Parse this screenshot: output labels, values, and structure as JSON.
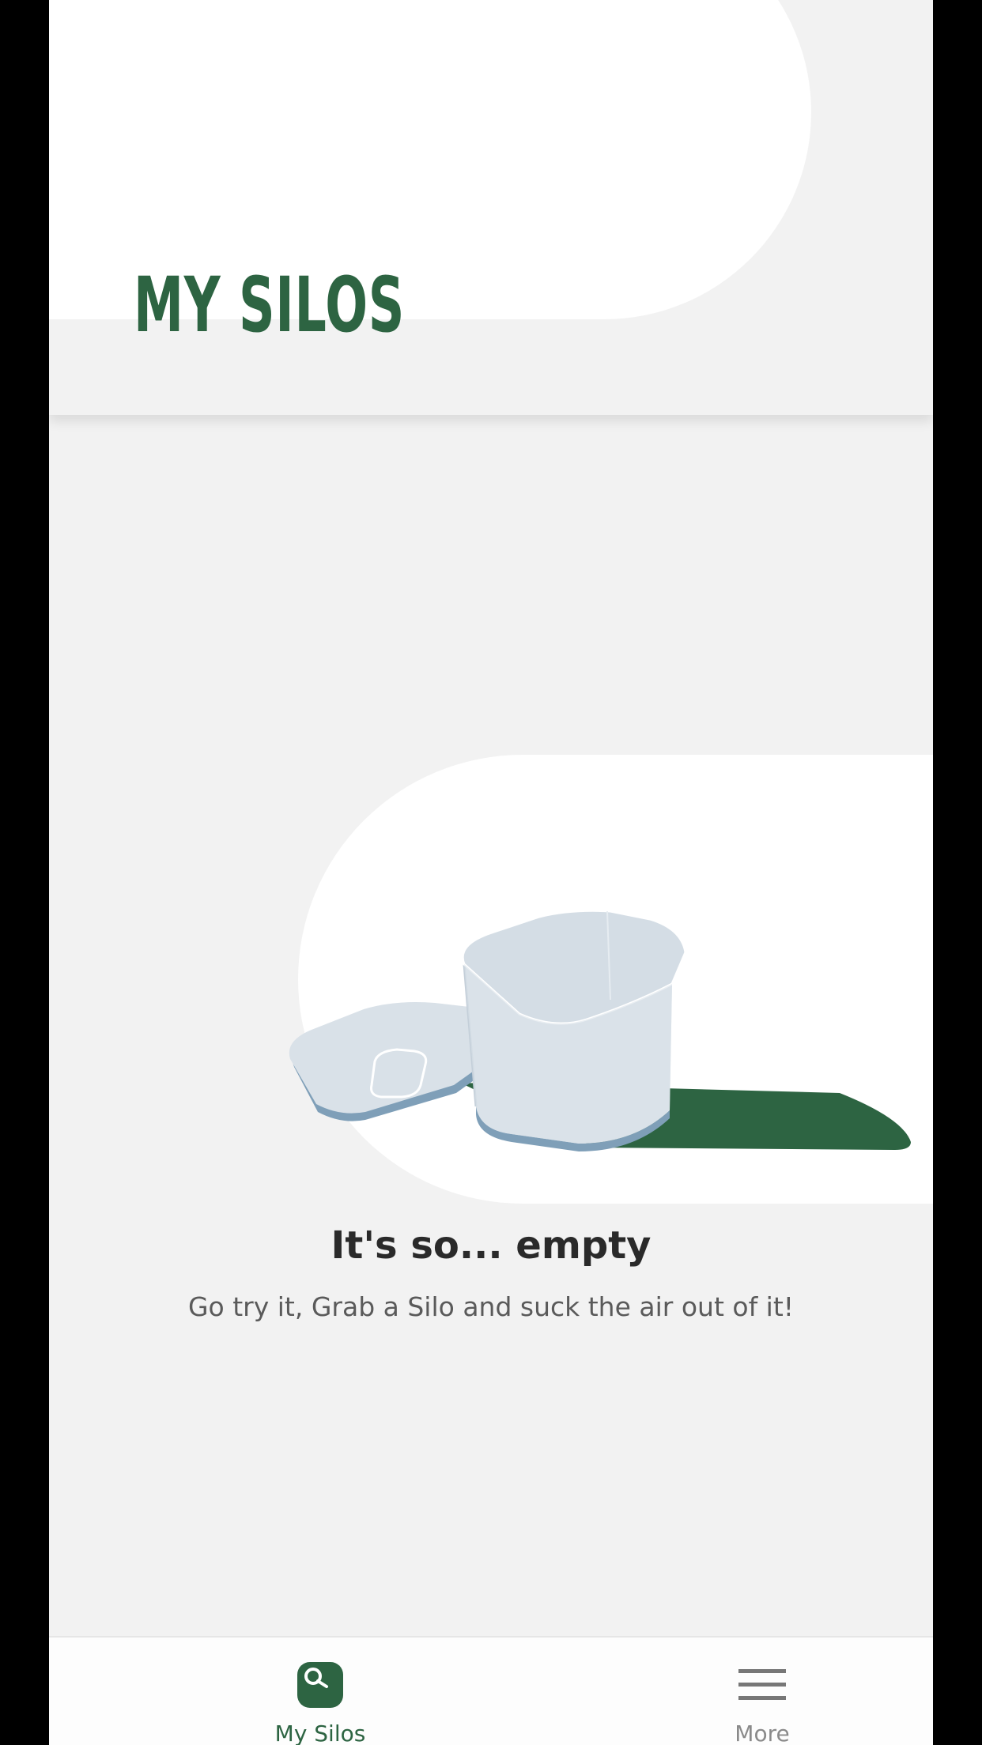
{
  "header": {
    "title": "MY SILOS"
  },
  "empty_state": {
    "title": "It's so... empty",
    "subtitle": "Go try it, Grab a Silo and suck the air out of it!",
    "illustration_icon": "silo-container-illustration"
  },
  "bottom_nav": {
    "items": [
      {
        "label": "My Silos",
        "icon": "silo-icon",
        "active": true
      },
      {
        "label": "More",
        "icon": "menu-icon",
        "active": false
      }
    ]
  },
  "colors": {
    "brand_green": "#2d6442",
    "background": "#f2f2f2",
    "inactive_gray": "#8a8a8a"
  }
}
